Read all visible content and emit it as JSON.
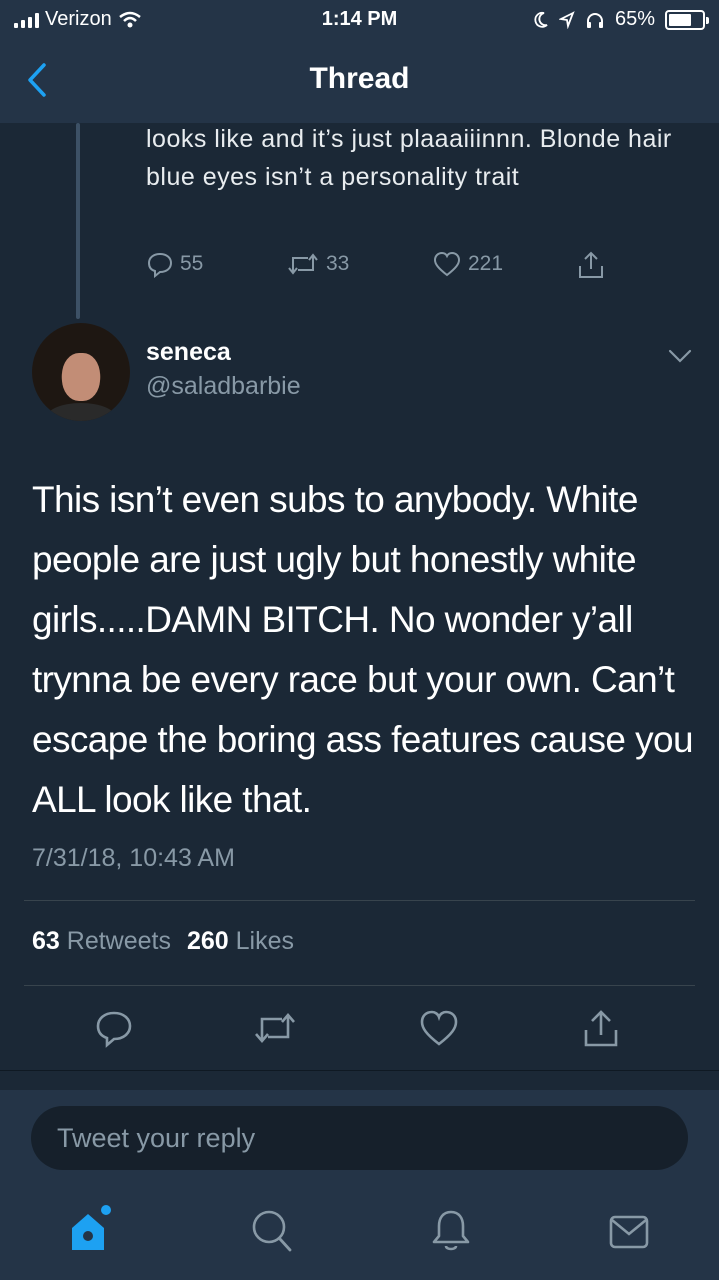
{
  "status_bar": {
    "carrier": "Verizon",
    "time": "1:14 PM",
    "battery": "65%"
  },
  "nav": {
    "title": "Thread",
    "back_icon": "chevron-left-icon"
  },
  "previous_tweet": {
    "text": "looks like and it’s just plaaaiiinnn. Blonde hair blue eyes isn’t a personality trait",
    "replies": "55",
    "retweets": "33",
    "likes": "221"
  },
  "main_tweet": {
    "display_name": "seneca",
    "handle": "@saladbarbie",
    "text": "This isn’t even subs to anybody. White people are just ugly but honestly white girls.....DAMN BITCH. No wonder y’all trynna be every race but your own. Can’t escape the boring ass features cause you ALL look like that.",
    "timestamp": "7/31/18, 10:43 AM",
    "retweet_count": "63",
    "retweet_label": "Retweets",
    "like_count": "260",
    "like_label": "Likes"
  },
  "reply": {
    "placeholder": "Tweet your reply"
  },
  "tabs": [
    "home-icon",
    "search-icon",
    "notifications-icon",
    "messages-icon"
  ],
  "colors": {
    "background": "#1b2836",
    "header": "#243447",
    "secondary_text": "#8899a6",
    "accent": "#1da1f2"
  }
}
